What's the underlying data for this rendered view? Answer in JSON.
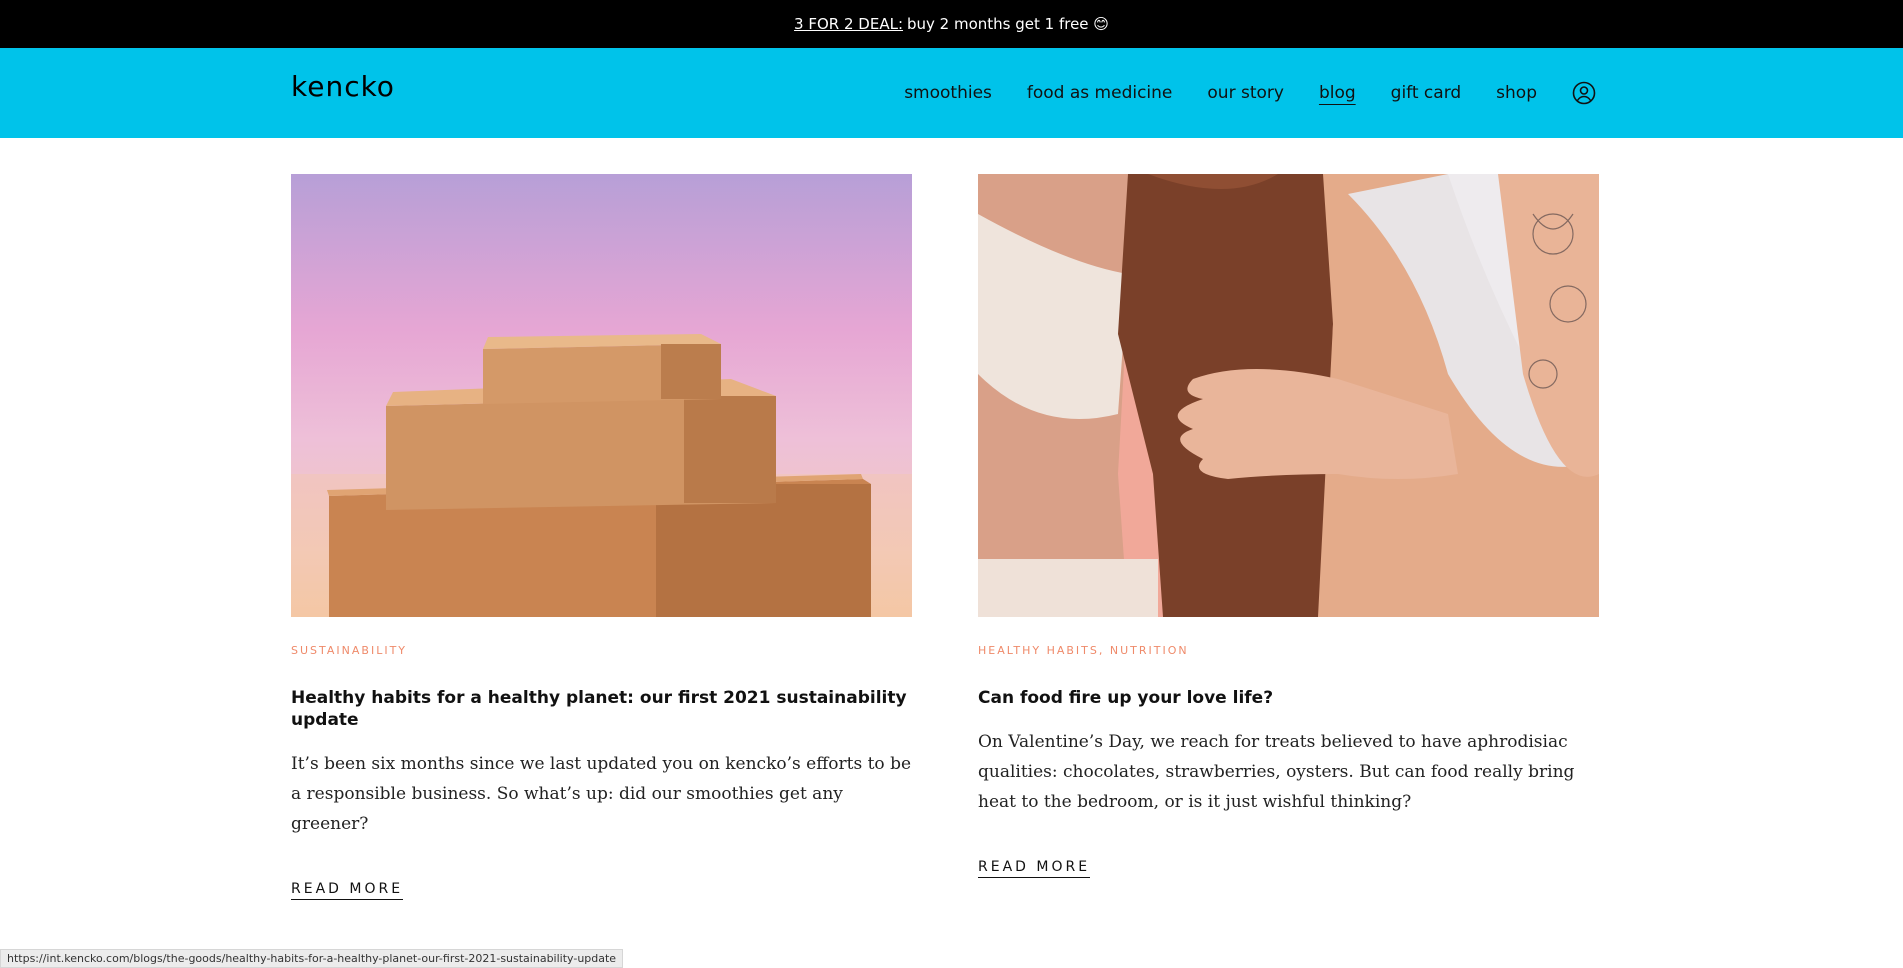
{
  "announcement": {
    "deal_link": "3 FOR 2 DEAL:",
    "deal_text": "buy 2 months get 1 free 😊"
  },
  "header": {
    "logo": "kencko",
    "nav": [
      {
        "label": "smoothies"
      },
      {
        "label": "food as medicine"
      },
      {
        "label": "our story"
      },
      {
        "label": "blog"
      },
      {
        "label": "gift card"
      },
      {
        "label": "shop"
      }
    ]
  },
  "cards": [
    {
      "tag": "SUSTAINABILITY",
      "title": "Healthy habits for a healthy planet: our first 2021 sustainability update",
      "excerpt": "It’s been six months since we last updated you on kencko’s efforts to be a responsible business. So what’s up: did our smoothies get any greener?",
      "read_more": "READ MORE"
    },
    {
      "tag": "HEALTHY HABITS, NUTRITION",
      "title": "Can food fire up your love life?",
      "excerpt": "On Valentine’s Day, we reach for treats believed to have aphrodisiac qualities: chocolates, strawberries, oysters. But can food really bring heat to the bedroom, or is it just wishful thinking?",
      "read_more": "READ MORE"
    }
  ],
  "statusbar": {
    "url": "https://int.kencko.com/blogs/the-goods/healthy-habits-for-a-healthy-planet-our-first-2021-sustainability-update"
  },
  "colors": {
    "header_bg": "#00c3ea",
    "tag": "#ef8a6a",
    "announce_bg": "#000000"
  }
}
